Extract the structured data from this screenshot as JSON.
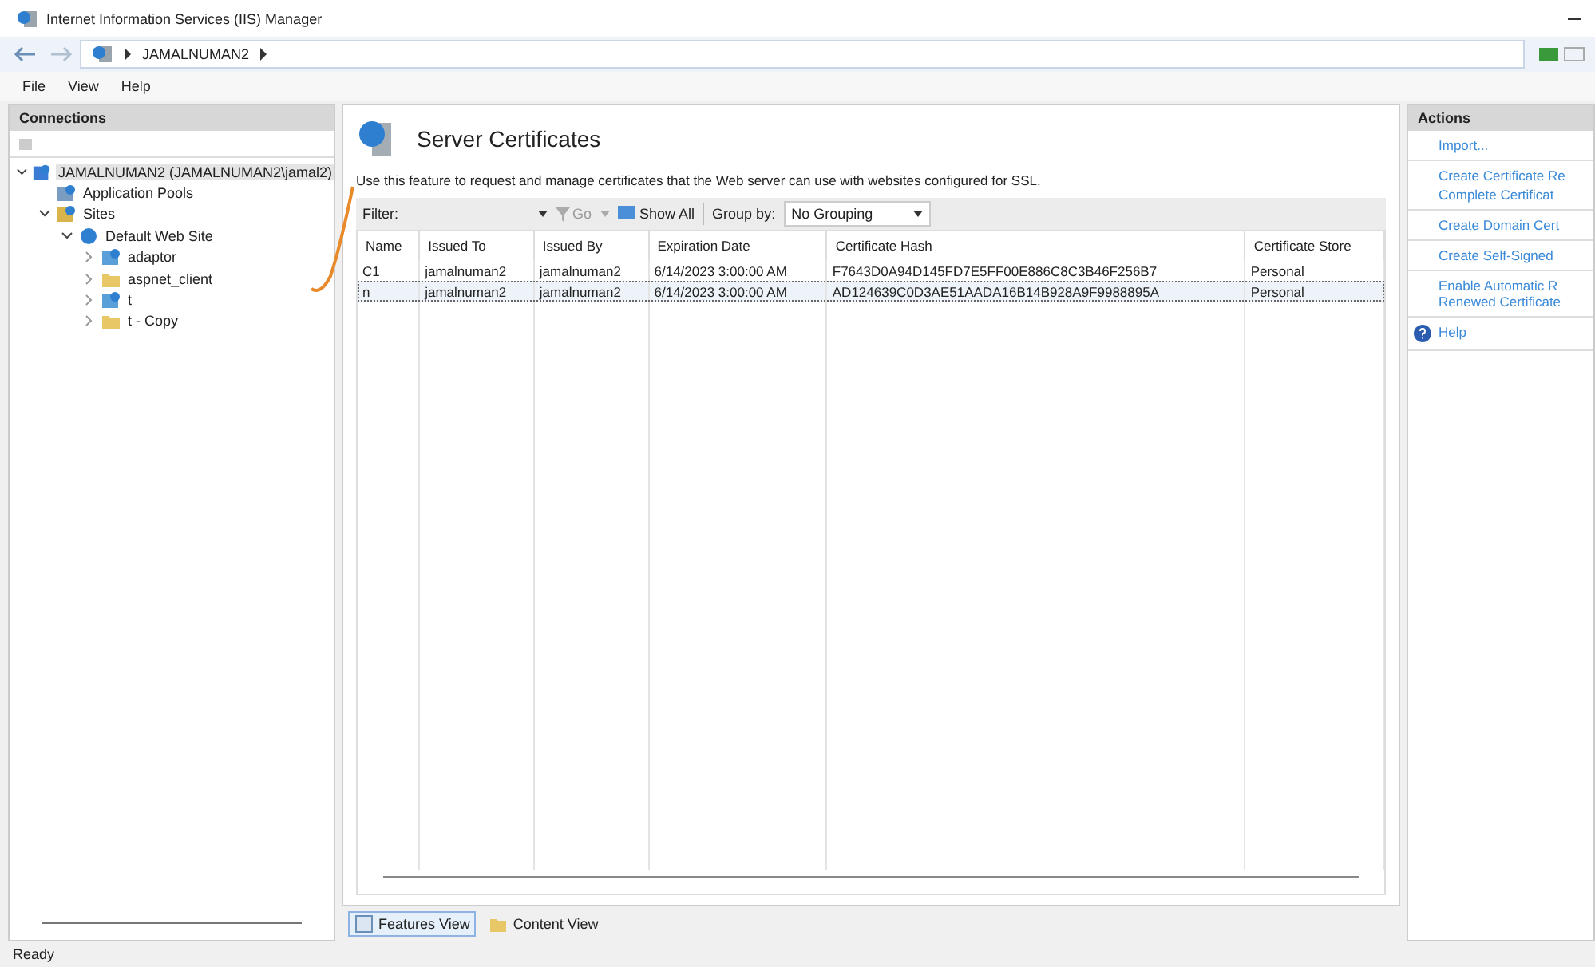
{
  "window": {
    "title": "Internet Information Services (IIS) Manager"
  },
  "address": {
    "crumbs": [
      "JAMALNUMAN2"
    ]
  },
  "menu": [
    "File",
    "View",
    "Help"
  ],
  "connections": {
    "title": "Connections",
    "tree": [
      {
        "label": "JAMALNUMAN2 (JAMALNUMAN2\\jamal2)",
        "kind": "server",
        "expanded": true,
        "selected": true,
        "children": [
          {
            "label": "Application Pools",
            "kind": "pool",
            "selected": false
          },
          {
            "label": "Sites",
            "kind": "sites",
            "expanded": true,
            "selected": false,
            "children": [
              {
                "label": "Default Web Site",
                "kind": "globe",
                "expanded": true,
                "selected": false,
                "children": [
                  {
                    "label": "adaptor",
                    "kind": "app",
                    "expanded": false,
                    "selected": false
                  },
                  {
                    "label": "aspnet_client",
                    "kind": "folder",
                    "expanded": false,
                    "selected": false
                  },
                  {
                    "label": "t",
                    "kind": "app",
                    "expanded": false,
                    "selected": false
                  },
                  {
                    "label": "t - Copy",
                    "kind": "folder",
                    "expanded": false,
                    "selected": false
                  }
                ]
              }
            ]
          }
        ]
      }
    ]
  },
  "feature": {
    "title": "Server Certificates",
    "description": "Use this feature to request and manage certificates that the Web server can use with websites configured for SSL.",
    "filter_label": "Filter:",
    "go": "Go",
    "show_all": "Show All",
    "group_by_label": "Group by:",
    "group_by_value": "No Grouping"
  },
  "table": {
    "columns": [
      "Name",
      "Issued To",
      "Issued By",
      "Expiration Date",
      "Certificate Hash",
      "Certificate Store"
    ],
    "rows": [
      {
        "cells": [
          "C1",
          "jamalnuman2",
          "jamalnuman2",
          "6/14/2023 3:00:00 AM",
          "F7643D0A94D145FD7E5FF00E886C8C3B46F256B7",
          "Personal"
        ],
        "selected": false
      },
      {
        "cells": [
          "n",
          "jamalnuman2",
          "jamalnuman2",
          "6/14/2023 3:00:00 AM",
          "AD124639C0D3AE51AADA16B14B928A9F9988895A",
          "Personal"
        ],
        "selected": true
      }
    ]
  },
  "views": [
    {
      "label": "Features View",
      "selected": true
    },
    {
      "label": "Content View",
      "selected": false
    }
  ],
  "actions": {
    "title": "Actions",
    "groups": [
      [
        {
          "lines": [
            "Import..."
          ]
        }
      ],
      [
        {
          "lines": [
            "Create Certificate Re"
          ]
        },
        {
          "lines": [
            "Complete Certificat"
          ]
        }
      ],
      [
        {
          "lines": [
            "Create Domain Cert"
          ]
        }
      ],
      [
        {
          "lines": [
            "Create Self-Signed"
          ]
        }
      ],
      [
        {
          "lines": [
            "Enable Automatic R",
            "Renewed Certificate"
          ]
        }
      ],
      [
        {
          "lines": [
            "Help"
          ],
          "kind": "help"
        }
      ]
    ]
  },
  "status_bar": {
    "text": "Ready"
  }
}
